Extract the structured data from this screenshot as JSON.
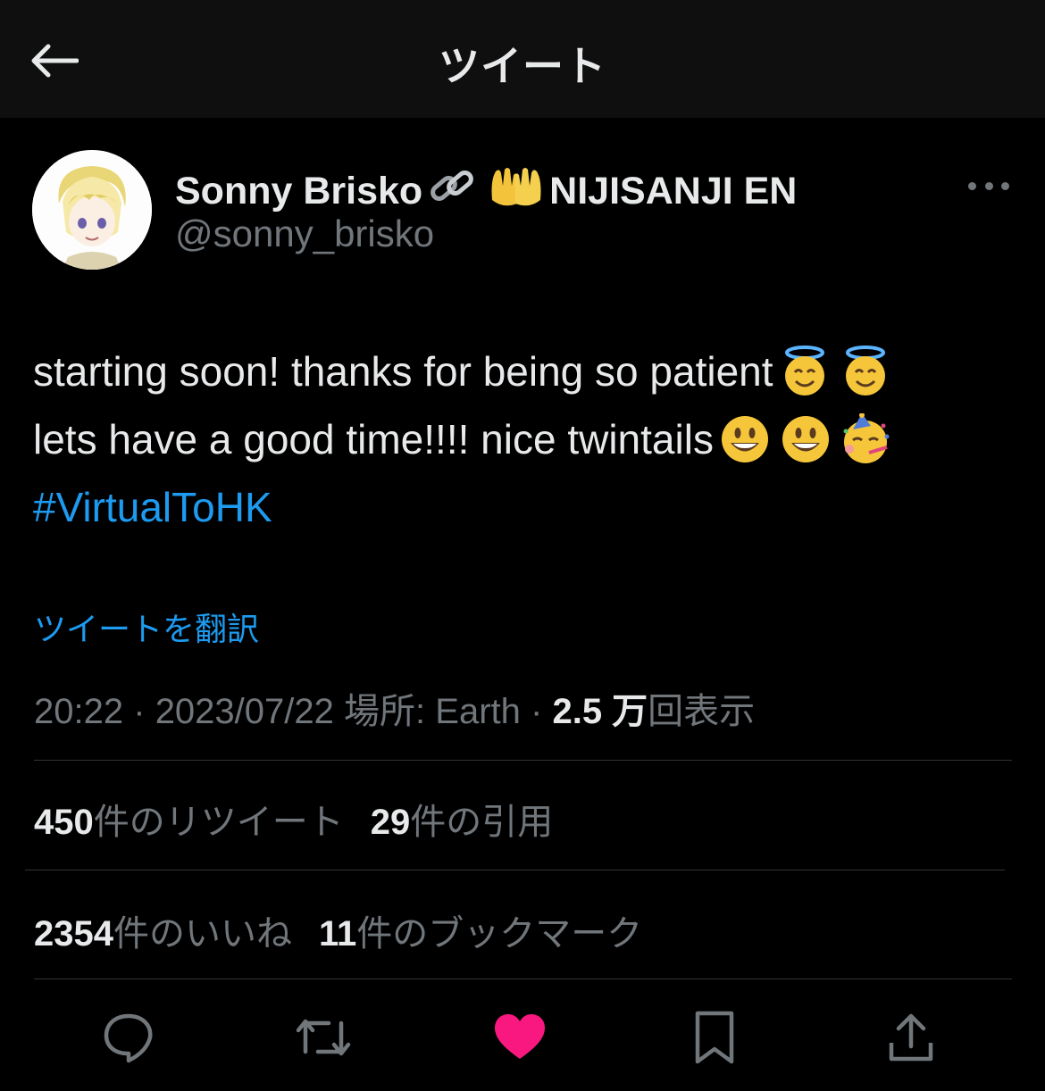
{
  "header": {
    "title": "ツイート",
    "back_icon": "arrow-left-icon"
  },
  "author": {
    "name": "Sonny Brisko",
    "badges": [
      "link-emoji",
      "palms-up-together-emoji"
    ],
    "affiliation": "NIJISANJI EN",
    "handle": "@sonny_brisko"
  },
  "tweet": {
    "line1": "starting soon! thanks for being so patient",
    "line2": "lets have a good time!!!! nice twintails",
    "hashtag": "#VirtualToHK",
    "line1_emojis": [
      "smiling-face-with-halo",
      "smiling-face-with-halo"
    ],
    "line2_emojis": [
      "grinning-face",
      "grinning-face",
      "partying-face"
    ]
  },
  "translate_label": "ツイートを翻訳",
  "meta": {
    "time": "20:22",
    "sep1": "·",
    "date": "2023/07/22",
    "location_label": "場所:",
    "location": "Earth",
    "sep2": "·",
    "views_count": "2.5 万",
    "views_label": "回表示"
  },
  "stats": {
    "retweets_count": "450",
    "retweets_label": "件のリツイート",
    "quotes_count": "29",
    "quotes_label": "件の引用",
    "likes_count": "2354",
    "likes_label": "件のいいね",
    "bookmarks_count": "11",
    "bookmarks_label": "件のブックマーク"
  },
  "actions": [
    "reply-icon",
    "retweet-icon",
    "like-icon",
    "bookmark-icon",
    "share-icon"
  ],
  "colors": {
    "accent": "#1d9bf0",
    "like": "#f91880",
    "secondary_text": "#71767b",
    "background": "#000000"
  }
}
